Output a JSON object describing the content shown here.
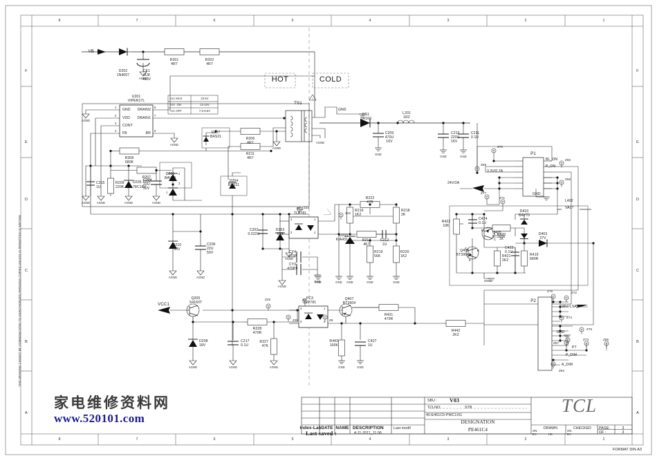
{
  "sheet": {
    "format_note": "FORMAT DIN A3",
    "side_notice": "THIS DRAWING CANNOT BE COMMUNICATED TO UNAUTHORIZED PERSONS COPIED UNLESS IS PERMITTED IN WRITING",
    "column_numbers": [
      "8",
      "7",
      "6",
      "5",
      "4",
      "3",
      "2",
      "1"
    ],
    "row_letters": [
      "F",
      "E",
      "D",
      "C",
      "B",
      "A"
    ]
  },
  "watermark": {
    "cn": "家电维修资料网",
    "url": "www.520101.com"
  },
  "zones": {
    "hot": "HOT",
    "cold": "COLD"
  },
  "vcc_table": {
    "rows": [
      {
        "name": "Vcc MAX",
        "value": "23.5V"
      },
      {
        "name": "Vcc  ON",
        "value": "13-15V"
      },
      {
        "name": "Vcc OFF",
        "value": "7.5-8.5V"
      }
    ]
  },
  "ic": {
    "u201": {
      "ref": "U201",
      "part": "VIPER17L",
      "pins_left": [
        {
          "n": "1",
          "name": "GND"
        },
        {
          "n": "2",
          "name": "VDD"
        },
        {
          "n": "3",
          "name": "CONT"
        },
        {
          "n": "4",
          "name": "FB"
        }
      ],
      "pins_right": [
        {
          "n": "8",
          "name": "DRAIN2"
        },
        {
          "n": "7",
          "name": "DRAIN1"
        },
        {
          "n": "5",
          "name": "BR"
        }
      ]
    },
    "u203": {
      "ref": "U203",
      "part": "KIA431"
    },
    "pc1": {
      "ref": "PC1",
      "part": "TLP781"
    },
    "pc3": {
      "ref": "PC3",
      "part": "TLP781"
    },
    "ts1": {
      "ref": "TS1"
    }
  },
  "nets": {
    "vb": "VB",
    "vcc1": "VCC1",
    "v24": "24V/2A",
    "v33": "3.3V/0.2A",
    "v98": "98V/1.5A",
    "bl_on": "BL_ON",
    "p_on": "P_ON",
    "p_dim": "P_DIM",
    "a_dim": "A_DIM",
    "pt": "PT",
    "val": "VAL?",
    "l402": "L402",
    "gnd": "GND",
    "agnd": "AGND",
    "p1": "P1",
    "p2": "P2"
  },
  "test_points": [
    "Z70",
    "Z69",
    "Z66",
    "Z68",
    "Z77",
    "Z71",
    "Z22",
    "Z23",
    "Z25",
    "Z26",
    "Z7",
    "Z8",
    "Z72",
    "Z73",
    "Z74",
    "Z75",
    "Z76",
    "Z84",
    "Z85",
    "Z87"
  ],
  "components": [
    {
      "ref": "D202",
      "val": "1N4007"
    },
    {
      "ref": "CE1",
      "val": "6U8\n450V"
    },
    {
      "ref": "R201",
      "val": "4R7"
    },
    {
      "ref": "R202",
      "val": "4R7"
    },
    {
      "ref": "D207",
      "val": "BAS21"
    },
    {
      "ref": "R206",
      "val": "4R7"
    },
    {
      "ref": "R211",
      "val": "4R7"
    },
    {
      "ref": "R308",
      "val": "680K"
    },
    {
      "ref": "R207",
      "val": "100R"
    },
    {
      "ref": "D206",
      "val": "BAV99"
    },
    {
      "ref": "D204",
      "val": "BAS21"
    },
    {
      "ref": "C215",
      "val": "1U"
    },
    {
      "ref": "R209",
      "val": "220K"
    },
    {
      "ref": "D205",
      "val": "78C18V"
    },
    {
      "ref": "C204",
      "val": "22U\n50V"
    },
    {
      "ref": "D210",
      "val": "33V"
    },
    {
      "ref": "C206",
      "val": "22U\n50V"
    },
    {
      "ref": "C202",
      "val": "0.022U"
    },
    {
      "ref": "D203",
      "val": "6V8"
    },
    {
      "ref": "CY4",
      "val": "470P"
    },
    {
      "ref": "CY3",
      "val": "470PF"
    },
    {
      "ref": "R216",
      "val": "1K2"
    },
    {
      "ref": "R222",
      "val": "47R"
    },
    {
      "ref": "R218",
      "val": "2K"
    },
    {
      "ref": "R217",
      "val": "4K7"
    },
    {
      "ref": "C212",
      "val": "1U"
    },
    {
      "ref": "R219",
      "val": "56K"
    },
    {
      "ref": "R220",
      "val": "1K2"
    },
    {
      "ref": "DS1",
      "val": "SR160"
    },
    {
      "ref": "C209",
      "val": "470U\n16V"
    },
    {
      "ref": "L201",
      "val": "1R2"
    },
    {
      "ref": "C210",
      "val": "220U\n16V"
    },
    {
      "ref": "C211",
      "val": "0.1U"
    },
    {
      "ref": "R422",
      "val": "10K"
    },
    {
      "ref": "C424",
      "val": "0.1U"
    },
    {
      "ref": "Q405",
      "val": "BT3906"
    },
    {
      "ref": "Q406",
      "val": "BT3904"
    },
    {
      "ref": "R421",
      "val": "2K2"
    },
    {
      "ref": "C423",
      "val": "0.1U"
    },
    {
      "ref": "D410",
      "val": "BAV70"
    },
    {
      "ref": "R420",
      "val": "1K"
    },
    {
      "ref": "R419",
      "val": "680R"
    },
    {
      "ref": "D403",
      "val": "27V"
    },
    {
      "ref": "Q205",
      "val": "S4160T"
    },
    {
      "ref": "D208",
      "val": "18V"
    },
    {
      "ref": "C217",
      "val": "0.1U"
    },
    {
      "ref": "R228",
      "val": "470R"
    },
    {
      "ref": "R227",
      "val": "47K"
    },
    {
      "ref": "Q407",
      "val": "BT3904"
    },
    {
      "ref": "R443",
      "val": "100K"
    },
    {
      "ref": "C427",
      "val": "1U"
    },
    {
      "ref": "R431",
      "val": "470R"
    },
    {
      "ref": "R442",
      "val": "2K2"
    }
  ],
  "title_block": {
    "sbu_label": "SBU :",
    "sbu_value": "V03",
    "tclno_label": "TCLNO:",
    "tclno_value": "STB",
    "part_number": "40-E461C0-PWC1XG",
    "designation_label": "DESIGNATION",
    "designation_value": "PE461C4",
    "rev_headers": [
      "Index-Lab",
      "DATE",
      "NAME",
      "DESCRIPTION",
      "Last modif"
    ],
    "last_saved_label": "Last saved :",
    "last_saved_value": "4-11-2011_11:06",
    "drawn_label": "DRAWN",
    "drawn_on": "ON:",
    "drawn_by": "BY:",
    "drawn_by_value": "HK",
    "checked_label": "CHECKED",
    "checked_on": "ON:",
    "checked_by": "BY:",
    "page_label": "PAGE:",
    "page_value": "3",
    "of_label": "OF :",
    "of_value": "3",
    "brand": "TCL"
  }
}
